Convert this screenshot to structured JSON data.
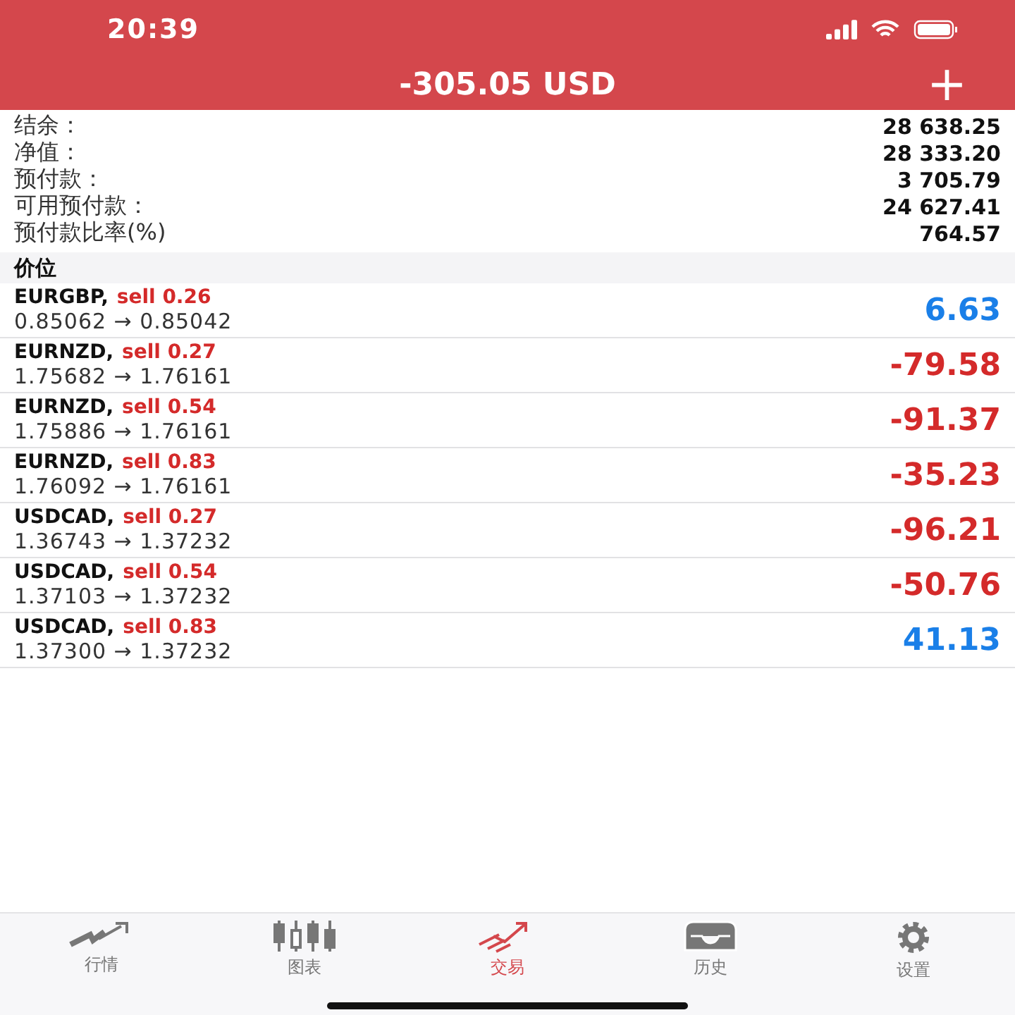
{
  "status_bar": {
    "time": "20:39"
  },
  "header": {
    "title": "-305.05 USD",
    "add_button": "+"
  },
  "summary": [
    {
      "label": "结余：",
      "value": "28 638.25"
    },
    {
      "label": "净值：",
      "value": "28 333.20"
    },
    {
      "label": "预付款：",
      "value": "3 705.79"
    },
    {
      "label": "可用预付款：",
      "value": "24 627.41"
    },
    {
      "label": "预付款比率(%)",
      "value": "764.57"
    }
  ],
  "section_title": "价位",
  "positions": [
    {
      "symbol": "EURGBP,",
      "side": "sell 0.26",
      "prices": "0.85062 → 0.85042",
      "profit": "6.63",
      "color": "#1a7fe8"
    },
    {
      "symbol": "EURNZD,",
      "side": "sell 0.27",
      "prices": "1.75682 → 1.76161",
      "profit": "-79.58",
      "color": "#d42a2a"
    },
    {
      "symbol": "EURNZD,",
      "side": "sell 0.54",
      "prices": "1.75886 → 1.76161",
      "profit": "-91.37",
      "color": "#d42a2a"
    },
    {
      "symbol": "EURNZD,",
      "side": "sell 0.83",
      "prices": "1.76092 → 1.76161",
      "profit": "-35.23",
      "color": "#d42a2a"
    },
    {
      "symbol": "USDCAD,",
      "side": "sell 0.27",
      "prices": "1.36743 → 1.37232",
      "profit": "-96.21",
      "color": "#d42a2a"
    },
    {
      "symbol": "USDCAD,",
      "side": "sell 0.54",
      "prices": "1.37103 → 1.37232",
      "profit": "-50.76",
      "color": "#d42a2a"
    },
    {
      "symbol": "USDCAD,",
      "side": "sell 0.83",
      "prices": "1.37300 → 1.37232",
      "profit": "41.13",
      "color": "#1a7fe8"
    }
  ],
  "tab_bar": [
    {
      "kind": "quotes",
      "label": "行情",
      "selected": false
    },
    {
      "kind": "charts",
      "label": "图表",
      "selected": false
    },
    {
      "kind": "trade",
      "label": "交易",
      "selected": true
    },
    {
      "kind": "history",
      "label": "历史",
      "selected": false
    },
    {
      "kind": "settings",
      "label": "设置",
      "selected": false
    }
  ]
}
